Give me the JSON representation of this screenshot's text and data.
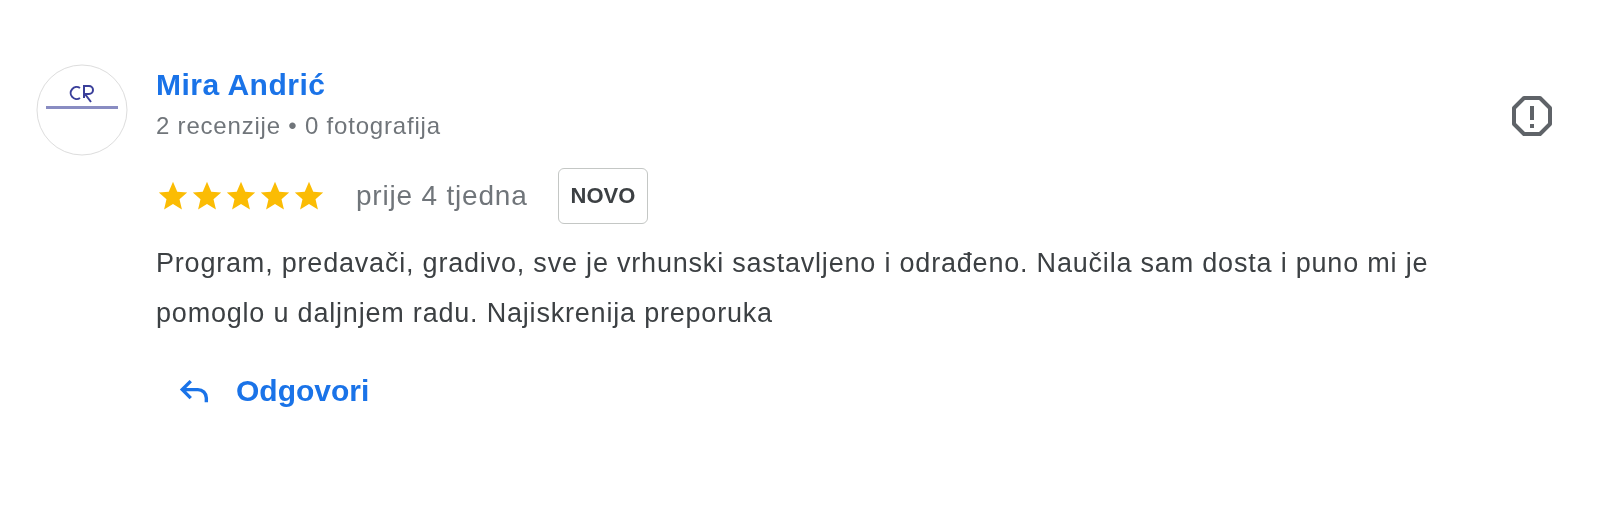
{
  "review": {
    "author": "Mira Andrić",
    "author_meta": "2 recenzije • 0 fotografija",
    "stars": 5,
    "time": "prije 4 tjedna",
    "badge": "NOVO",
    "text": "Program, predavači, gradivo, sve je vrhunski sastavljeno i odrađeno. Naučila sam dosta i puno mi je pomoglo u daljnjem radu. Najiskrenija preporuka",
    "reply_label": "Odgovori"
  }
}
